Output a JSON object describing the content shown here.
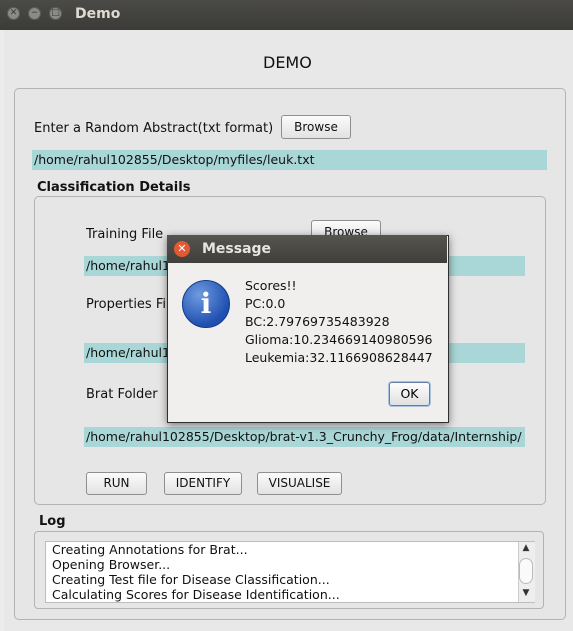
{
  "window": {
    "title": "Demo"
  },
  "app": {
    "heading": "DEMO"
  },
  "abstract": {
    "label": "Enter a Random Abstract(txt format)",
    "browse_label": "Browse",
    "path": "/home/rahul102855/Desktop/myfiles/leuk.txt"
  },
  "classification": {
    "title": "Classification Details",
    "training_label": "Training File",
    "training_browse_label": "Browse",
    "training_path": "/home/rahul1",
    "properties_label": "Properties Fil",
    "properties_path": "/home/rahul1",
    "brat_label": "Brat Folder",
    "brat_path": "/home/rahul102855/Desktop/brat-v1.3_Crunchy_Frog/data/Internship/",
    "run_label": "RUN",
    "identify_label": "IDENTIFY",
    "visualise_label": "VISUALISE"
  },
  "log": {
    "title": "Log",
    "lines": [
      "Creating Annotations for Brat...",
      "Opening Browser...",
      "Creating Test file for Disease Classification...",
      "Calculating Scores for Disease Identification..."
    ]
  },
  "dialog": {
    "title": "Message",
    "lines": [
      "Scores!!",
      "PC:0.0",
      "BC:2.79769735483928",
      "Glioma:10.234669140980596",
      "Leukemia:32.1166908628447"
    ],
    "ok_label": "OK"
  },
  "colors": {
    "field_bg": "#a9d6d6",
    "titlebar": "#3c3b37",
    "close_button": "#e15a34",
    "info_icon": "#1f4fb0"
  },
  "icons": [
    "close-icon",
    "minimize-icon",
    "maximize-icon",
    "info-icon",
    "scroll-up-icon",
    "scroll-down-icon"
  ]
}
